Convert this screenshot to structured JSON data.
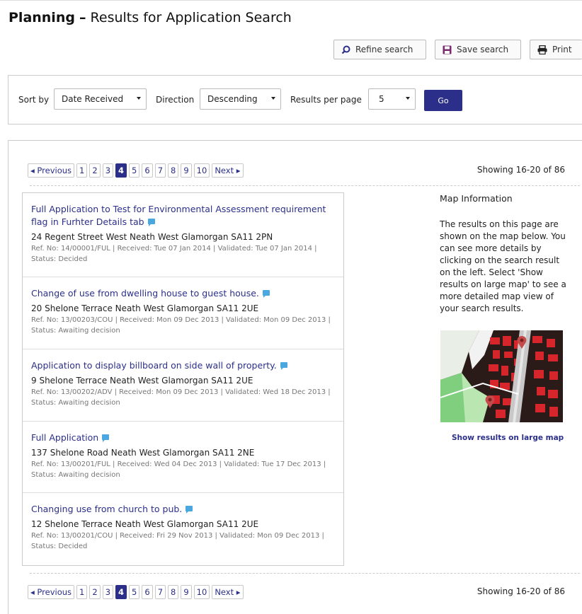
{
  "header": {
    "title_bold": "Planning",
    "title_dash": "–",
    "title_rest": "Results for Application Search"
  },
  "actions": {
    "refine": "Refine search",
    "save": "Save search",
    "print": "Print"
  },
  "sort": {
    "sort_by_label": "Sort by",
    "sort_by_value": "Date Received",
    "direction_label": "Direction",
    "direction_value": "Descending",
    "per_page_label": "Results per page",
    "per_page_value": "5",
    "go_label": "Go"
  },
  "pagination": {
    "previous": "◂ Previous",
    "next": "Next ▸",
    "pages": [
      "1",
      "2",
      "3",
      "4",
      "5",
      "6",
      "7",
      "8",
      "9",
      "10"
    ],
    "current": "4",
    "showing": "Showing 16-20 of 86"
  },
  "results": [
    {
      "title": "Full Application to Test for Environmental Assessment requirement flag in Furhter Details tab",
      "address": "24 Regent Street West Neath West Glamorgan SA11 2PN",
      "meta": "Ref. No: 14/00001/FUL | Received: Tue 07 Jan 2014 | Validated: Tue 07 Jan 2014 | Status: Decided"
    },
    {
      "title": "Change of use from dwelling house to guest house.",
      "address": "20 Shelone Terrace Neath West Glamorgan SA11 2UE",
      "meta": "Ref. No: 13/00203/COU | Received: Mon 09 Dec 2013 | Validated: Mon 09 Dec 2013 | Status: Awaiting decision"
    },
    {
      "title": "Application to display billboard on side wall of property.",
      "address": "9 Shelone Terrace Neath West Glamorgan SA11 2UE",
      "meta": "Ref. No: 13/00202/ADV | Received: Mon 09 Dec 2013 | Validated: Wed 18 Dec 2013 | Status: Awaiting decision"
    },
    {
      "title": "Full Application",
      "address": "137 Shelone Road Neath West Glamorgan SA11 2NE",
      "meta": "Ref. No: 13/00201/FUL | Received: Wed 04 Dec 2013 | Validated: Tue 17 Dec 2013 | Status: Awaiting decision"
    },
    {
      "title": "Changing use from church to pub.",
      "address": "12 Shelone Terrace Neath West Glamorgan SA11 2UE",
      "meta": "Ref. No: 13/00201/COU | Received: Fri 29 Nov 2013 | Validated: Mon 09 Dec 2013 | Status: Decided"
    }
  ],
  "map": {
    "heading": "Map Information",
    "text": "The results on this page are shown on the map below. You can see more details by clicking on the search result on the left. Select 'Show results on large map' to see a more detailed map view of your search results.",
    "link": "Show results on large map"
  },
  "colors": {
    "accent": "#2b2f8a",
    "comment": "#4aa7e0"
  }
}
